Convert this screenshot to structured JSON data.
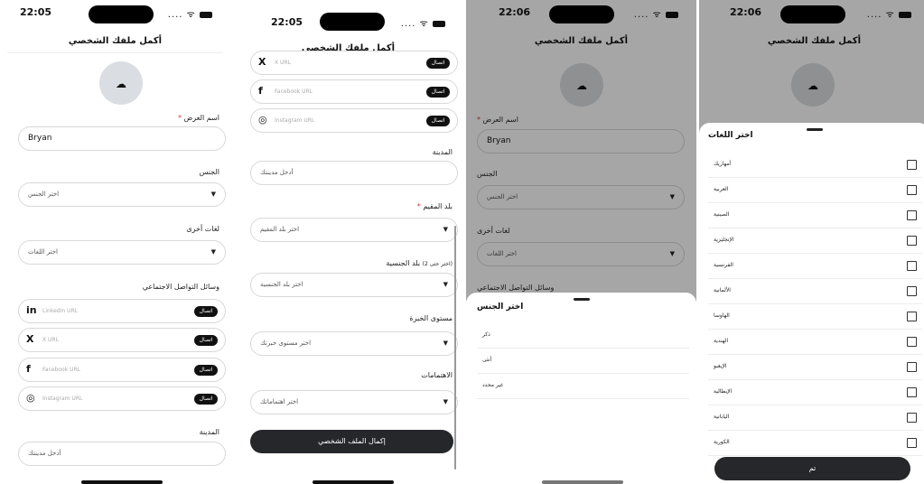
{
  "status": {
    "s1_time": "22:05",
    "s2_time": "22:05",
    "s3_time": "22:06",
    "s4_time": "22:06",
    "signal": "....",
    "wifi": "ᯤ"
  },
  "page": {
    "title": "أكمل ملفك الشخصي",
    "upload_icon": "☁"
  },
  "form": {
    "display_name_label": "اسم العرض",
    "display_name_value": "Bryan",
    "gender_label": "الجنس",
    "gender_placeholder": "اختر الجنس",
    "languages_label": "لغات أخرى",
    "languages_placeholder": "اختر اللغات",
    "social_label": "وسائل التواصل الاجتماعي",
    "social": [
      {
        "icon": "in",
        "placeholder": "LinkedIn URL",
        "button": "اتصال"
      },
      {
        "icon": "X",
        "placeholder": "X URL",
        "button": "اتصال"
      },
      {
        "icon": "f",
        "placeholder": "Facebook URL",
        "button": "اتصال"
      },
      {
        "icon": "◎",
        "placeholder": "Instagram URL",
        "button": "اتصال"
      }
    ],
    "city_label": "المدينة",
    "city_placeholder": "أدخل مدينتك",
    "residence_label": "بلد المقيم",
    "residence_placeholder": "اختر بلد المقيم",
    "nationality_label": "بلد الجنسية",
    "nationality_hint": "(اختر حتى 2)",
    "nationality_placeholder": "اختر بلد الجنسية",
    "experience_label": "مستوى الخبرة",
    "experience_placeholder": "اختر مستوى خبرتك",
    "interests_label": "الاهتمامات",
    "interests_placeholder": "اختر اهتماماتك",
    "submit": "إكمال الملف الشخصي",
    "chevron": "▼",
    "required": "*"
  },
  "gender_sheet": {
    "title": "اختر الجنس",
    "options": [
      "ذكر",
      "أنثى",
      "غير محدد"
    ]
  },
  "languages_sheet": {
    "title": "اختر اللغات",
    "options": [
      "أمهاريك",
      "العربية",
      "الصينية",
      "الإنجليزية",
      "الفرنسية",
      "الألمانية",
      "الهاوسا",
      "الهندية",
      "الإيغبو",
      "الإيطالية",
      "اليابانية",
      "الكورية"
    ],
    "done": "تم"
  }
}
